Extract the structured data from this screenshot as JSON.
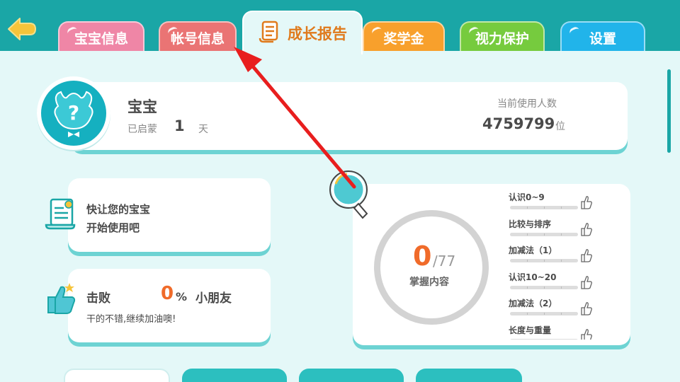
{
  "tabs": {
    "baby": "宝宝信息",
    "account": "帐号信息",
    "growth": "成长报告",
    "scholarship": "奖学金",
    "vision": "视力保护",
    "settings": "设置"
  },
  "profile": {
    "name": "宝宝",
    "enlight_label": "已启蒙",
    "enlight_days": "1",
    "enlight_unit": "天",
    "users_label": "当前使用人数",
    "users_count": "4759799",
    "users_unit": "位"
  },
  "hint": {
    "line1": "快让您的宝宝",
    "line2": "开始使用吧"
  },
  "beat": {
    "label": "击败",
    "percent": "0",
    "percent_sign": "%",
    "friend": "小朋友",
    "sub": "干的不错,继续加油噢!"
  },
  "mastery": {
    "mastered": "0",
    "total": "/77",
    "label": "掌握内容",
    "skills": [
      {
        "name": "认识0~9"
      },
      {
        "name": "比较与排序"
      },
      {
        "name": "加减法（1）"
      },
      {
        "name": "认识10~20"
      },
      {
        "name": "加减法（2）"
      },
      {
        "name": "长度与重量"
      }
    ]
  },
  "bottom": {
    "b1": "",
    "b2": "",
    "b3": "",
    "b4": ""
  },
  "colors": {
    "teal": "#1aa6a6",
    "orange": "#f06b2a",
    "annotation_arrow": "#e81e1e"
  }
}
